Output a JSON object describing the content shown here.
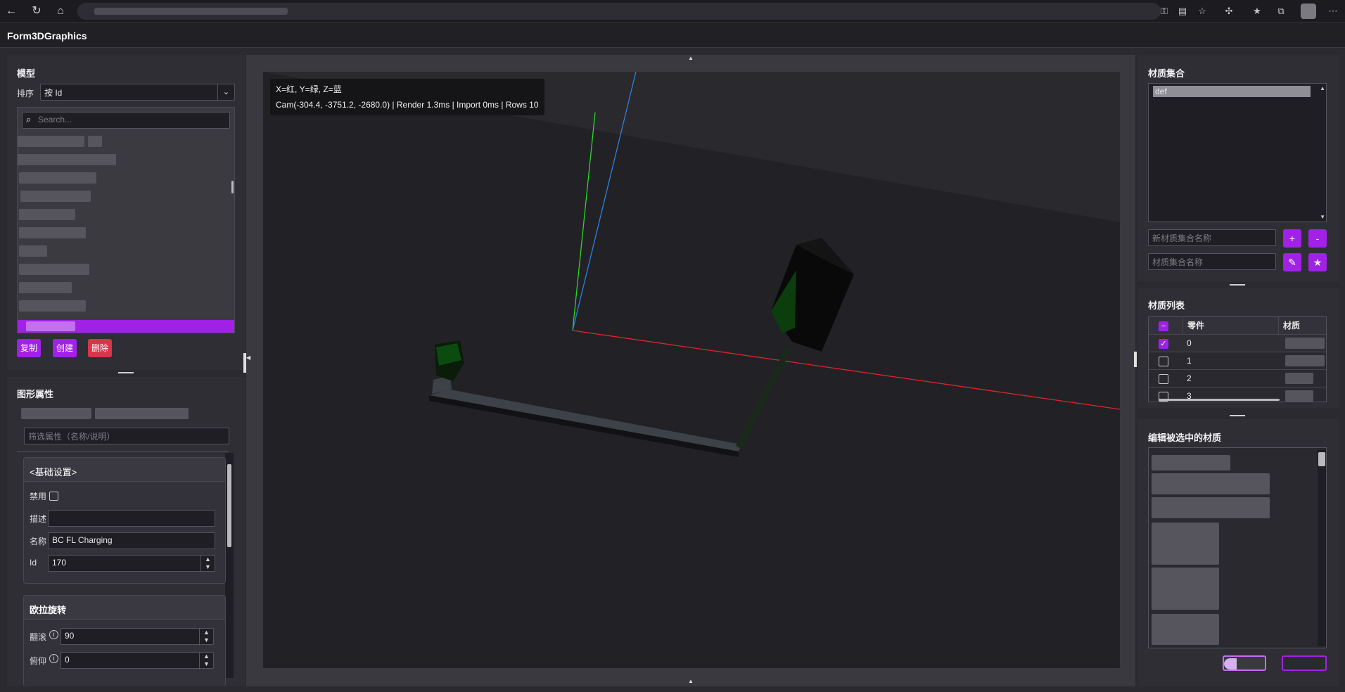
{
  "app": {
    "title": "Form3DGraphics"
  },
  "left": {
    "model_title": "模型",
    "sort_label": "排序",
    "sort_value": "按 Id",
    "search_placeholder": "Search...",
    "buttons": {
      "copy": "复制",
      "create": "创建",
      "delete": "删除"
    },
    "props_title": "图形属性",
    "filter_placeholder": "筛选属性（名称/说明）",
    "basic": {
      "header": "<基础设置>",
      "disabled_label": "禁用",
      "desc_label": "描述",
      "desc_value": "",
      "name_label": "名称",
      "name_value": "BC FL Charging",
      "id_label": "Id",
      "id_value": "170"
    },
    "euler": {
      "header": "欧拉旋转",
      "roll_label": "翻滚",
      "roll_value": "90",
      "pitch_label": "俯仰",
      "pitch_value": "0"
    }
  },
  "viewport": {
    "hud_line1": "X=红, Y=绿, Z=蓝",
    "hud_line2": "Cam(-304.4, -3751.2, -2680.0) | Render 1.3ms | Import 0ms | Rows 10"
  },
  "right": {
    "matset_title": "材质集合",
    "matset_items": [
      "def"
    ],
    "new_set_placeholder": "新材质集合名称",
    "set_name_placeholder": "材质集合名称",
    "btn_add": "+",
    "btn_remove": "-",
    "matlist_title": "材质列表",
    "col_part": "零件",
    "col_material": "材质",
    "rows": [
      {
        "part": "0",
        "checked": true
      },
      {
        "part": "1",
        "checked": false
      },
      {
        "part": "2",
        "checked": false
      },
      {
        "part": "3",
        "checked": false
      }
    ],
    "edit_title": "编辑被选中的材质"
  },
  "colors": {
    "accent": "#a121e6",
    "danger": "#d9354a",
    "axis_x": "#e0242c",
    "axis_y": "#2bd62b",
    "axis_z": "#2f7fe0"
  }
}
